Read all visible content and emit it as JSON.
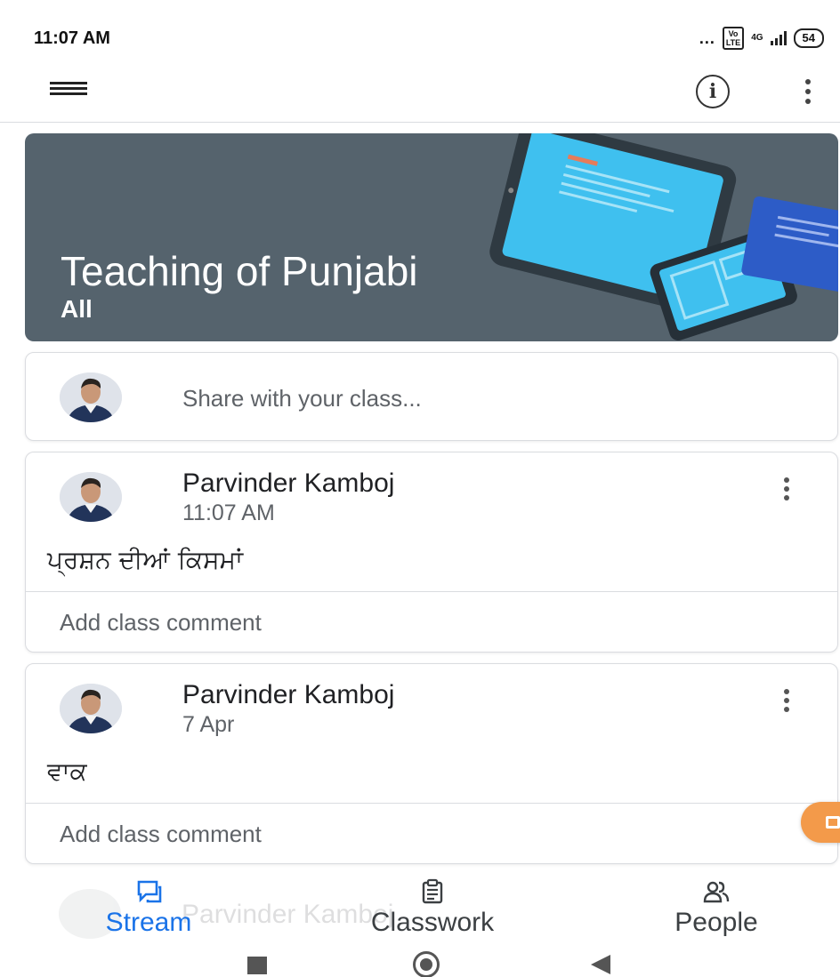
{
  "status_bar": {
    "time": "11:07 AM",
    "signal_dots": "...",
    "volte": "Vo\nLTE",
    "network": "4G",
    "battery": "54"
  },
  "app_bar": {
    "menu_icon": "hamburger-menu-icon",
    "info_icon": "info-icon",
    "more_icon": "more-vert-icon"
  },
  "banner": {
    "title": "Teaching of Punjabi",
    "section": "All",
    "background_color": "#55636d"
  },
  "share": {
    "placeholder": "Share with your class..."
  },
  "posts": [
    {
      "author": "Parvinder Kamboj",
      "time": "11:07 AM",
      "body": "ਪ੍ਰਸ਼ਨ ਦੀਆਂ ਕਿਸਮਾਂ",
      "comment_placeholder": "Add class comment"
    },
    {
      "author": "Parvinder Kamboj",
      "time": "7 Apr",
      "body": "ਵਾਕ",
      "comment_placeholder": "Add class comment"
    }
  ],
  "ghost_post": {
    "author": "Parvinder Kamboj"
  },
  "bottom_nav": {
    "tabs": [
      {
        "label": "Stream",
        "icon": "stream-icon",
        "active": true
      },
      {
        "label": "Classwork",
        "icon": "classwork-icon",
        "active": false
      },
      {
        "label": "People",
        "icon": "people-icon",
        "active": false
      }
    ],
    "active_color": "#1a73e8"
  },
  "system_nav": {
    "recent_icon": "recent-apps-icon",
    "home_icon": "home-icon",
    "back_icon": "back-icon"
  }
}
